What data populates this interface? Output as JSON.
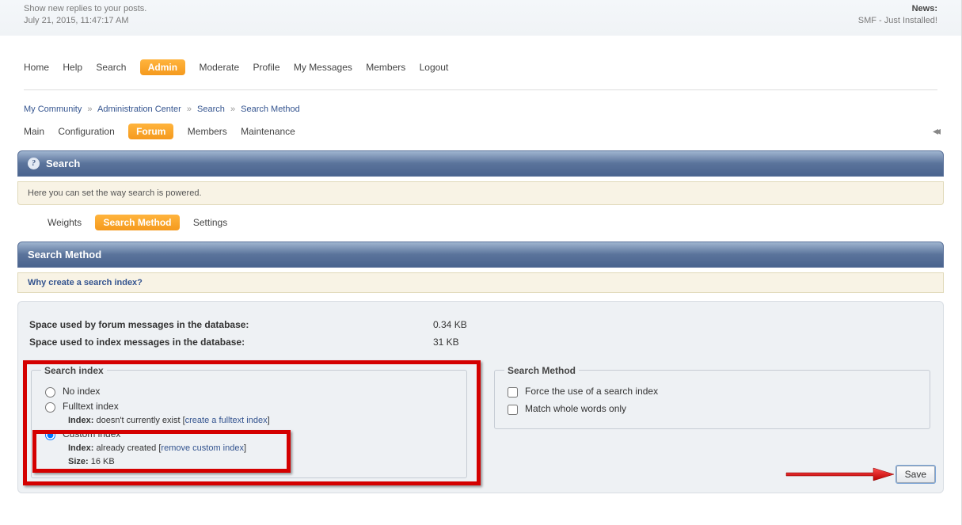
{
  "top": {
    "show_replies": "Show new replies to your posts.",
    "datetime": "July 21, 2015, 11:47:17 AM",
    "news_title": "News:",
    "news_text": "SMF - Just Installed!"
  },
  "nav": {
    "items": [
      "Home",
      "Help",
      "Search",
      "Admin",
      "Moderate",
      "Profile",
      "My Messages",
      "Members",
      "Logout"
    ],
    "active_index": 3
  },
  "breadcrumb": {
    "parts": [
      "My Community",
      "Administration Center",
      "Search",
      "Search Method"
    ]
  },
  "admin_tabs": {
    "items": [
      "Main",
      "Configuration",
      "Forum",
      "Members",
      "Maintenance"
    ],
    "active_index": 2
  },
  "section": {
    "title": "Search",
    "desc": "Here you can set the way search is powered."
  },
  "subtabs": {
    "items": [
      "Weights",
      "Search Method",
      "Settings"
    ],
    "active_index": 1
  },
  "panel_title": "Search Method",
  "hint_link": "Why create a search index?",
  "stats": {
    "msg_space_label": "Space used by forum messages in the database:",
    "msg_space_val": "0.34 KB",
    "idx_space_label": "Space used to index messages in the database:",
    "idx_space_val": "31 KB"
  },
  "search_index": {
    "legend": "Search index",
    "no_index": "No index",
    "fulltext": "Fulltext index",
    "fulltext_index_label": "Index:",
    "fulltext_status": "doesn't currently exist",
    "fulltext_link": "create a fulltext index",
    "custom": "Custom index",
    "custom_index_label": "Index:",
    "custom_status": "already created",
    "custom_link": "remove custom index",
    "size_label": "Size:",
    "size_val": "16 KB"
  },
  "search_method": {
    "legend": "Search Method",
    "force": "Force the use of a search index",
    "whole": "Match whole words only"
  },
  "save_label": "Save"
}
